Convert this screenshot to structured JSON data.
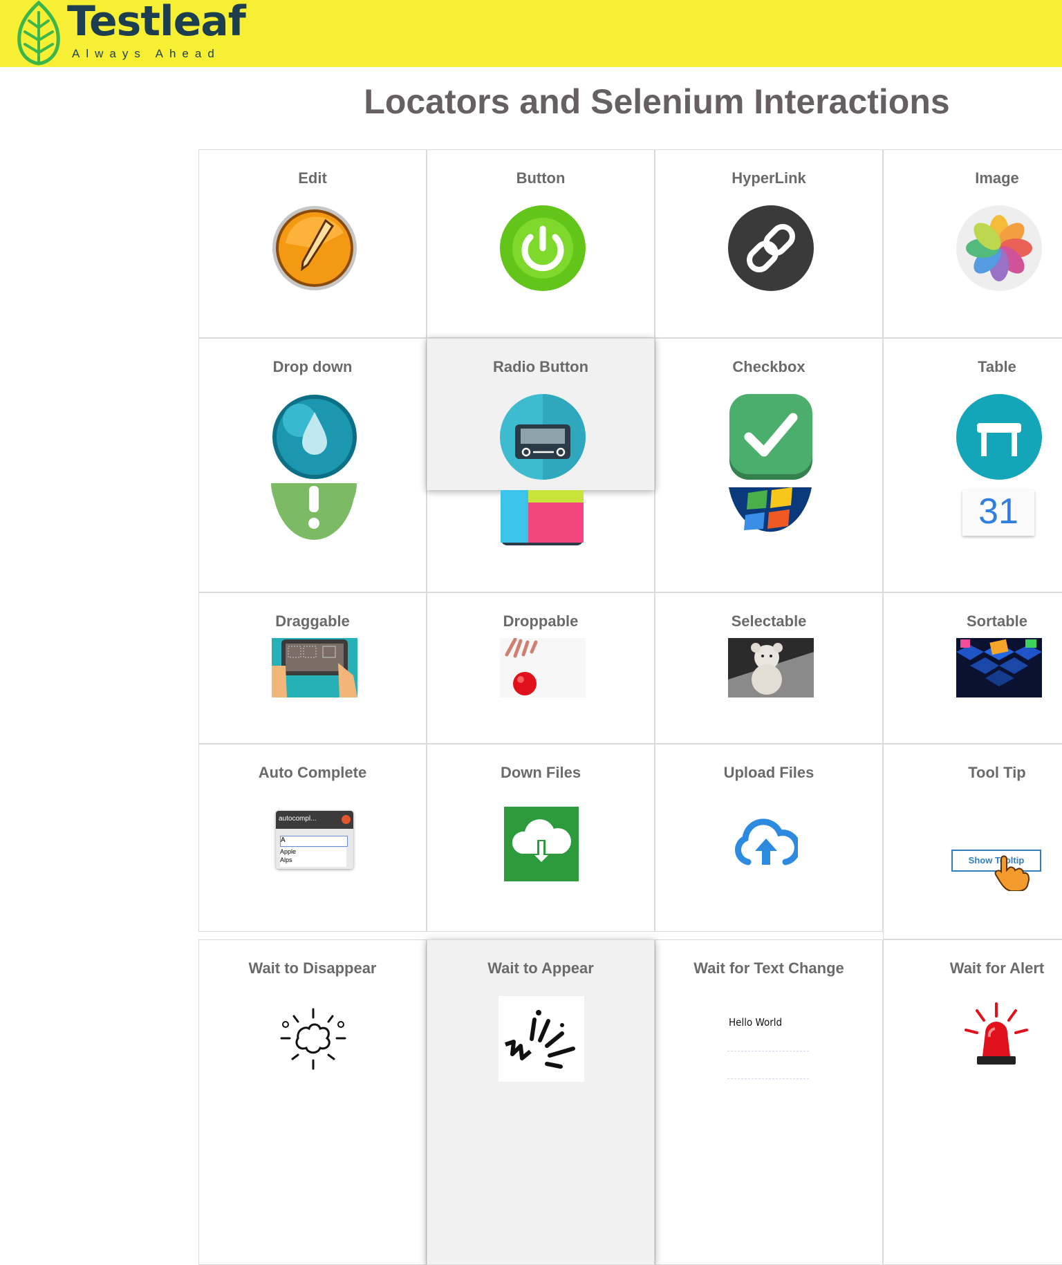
{
  "brand": {
    "name": "Testleaf",
    "tagline": "Always Ahead"
  },
  "page": {
    "title": "Locators and Selenium Interactions"
  },
  "tiles": [
    {
      "label": "Edit",
      "icon": "pencil-icon"
    },
    {
      "label": "Button",
      "icon": "power-icon"
    },
    {
      "label": "HyperLink",
      "icon": "link-icon"
    },
    {
      "label": "Image",
      "icon": "photos-icon"
    },
    {
      "label": "Drop down",
      "icon": "drop-icon"
    },
    {
      "label": "Radio Button",
      "icon": "radio-icon"
    },
    {
      "label": "Checkbox",
      "icon": "checkmark-icon"
    },
    {
      "label": "Table",
      "icon": "table-icon"
    },
    {
      "label": "Draggable",
      "icon": "tablet-drag-icon"
    },
    {
      "label": "Droppable",
      "icon": "drop-ball-icon"
    },
    {
      "label": "Selectable",
      "icon": "teddy-bear-image"
    },
    {
      "label": "Sortable",
      "icon": "cubes-image"
    },
    {
      "label": "Auto Complete",
      "icon": "autocomplete-window-icon"
    },
    {
      "label": "Down Files",
      "icon": "cloud-download-icon"
    },
    {
      "label": "Upload Files",
      "icon": "cloud-upload-icon"
    },
    {
      "label": "Tool Tip",
      "icon": "tooltip-icon"
    },
    {
      "label": "Wait to Disappear",
      "icon": "explosion-icon"
    },
    {
      "label": "Wait to Appear",
      "icon": "spark-icon"
    },
    {
      "label": "Wait for Text Change",
      "icon": "text-change-icon"
    },
    {
      "label": "Wait for Alert",
      "icon": "siren-icon"
    }
  ],
  "overflow_icons": [
    "alert-exclamation-icon",
    "frame-icon",
    "windows-logo-icon",
    "calendar-icon"
  ],
  "autocomplete_demo": {
    "window_title": "autocompl...",
    "input_value": "A",
    "options": [
      "Apple",
      "Alps"
    ]
  },
  "tooltip_demo": {
    "button_label": "Show Tooltip"
  },
  "text_change_demo": {
    "text": "Hello World"
  },
  "calendar_demo": {
    "day": "31"
  },
  "colors": {
    "header_bg": "#f7ef33",
    "brand_text": "#1d3e4e",
    "leaf_green": "#3cb54a",
    "title_text": "#666063",
    "label_text": "#6a6a6a",
    "cell_border": "#dadada",
    "highlight_bg": "#f1f1f1"
  }
}
